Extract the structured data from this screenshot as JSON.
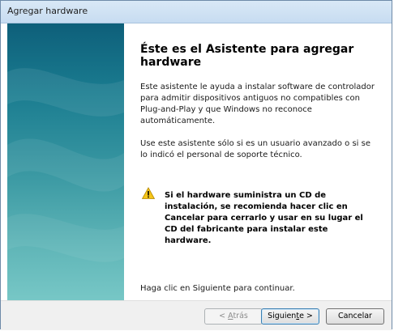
{
  "window": {
    "title": "Agregar hardware"
  },
  "main": {
    "heading": "Éste es el Asistente para agregar hardware",
    "paragraph1": "Este asistente le ayuda a instalar software de controlador para admitir dispositivos antiguos no compatibles con Plug-and-Play y que Windows no reconoce automáticamente.",
    "paragraph2": "Use este asistente sólo si es un usuario avanzado o si se lo indicó el personal de soporte técnico.",
    "warning": "Si el hardware suministra un CD de instalación, se recomienda hacer clic en Cancelar para cerrarlo y usar en su lugar el CD del fabricante para instalar este hardware.",
    "continue_text": "Haga clic en Siguiente para continuar."
  },
  "footer": {
    "back": {
      "prefix": "< ",
      "mnemonic": "A",
      "rest": "trás"
    },
    "next": {
      "text": "Siguien",
      "mnemonic": "t",
      "rest": "e >"
    },
    "cancel": "Cancelar"
  },
  "icons": {
    "warning": "warning-icon"
  },
  "colors": {
    "sidebar_top": "#0e5f7a",
    "sidebar_bottom": "#77c7c6",
    "footer_bg": "#f0f0f0"
  }
}
